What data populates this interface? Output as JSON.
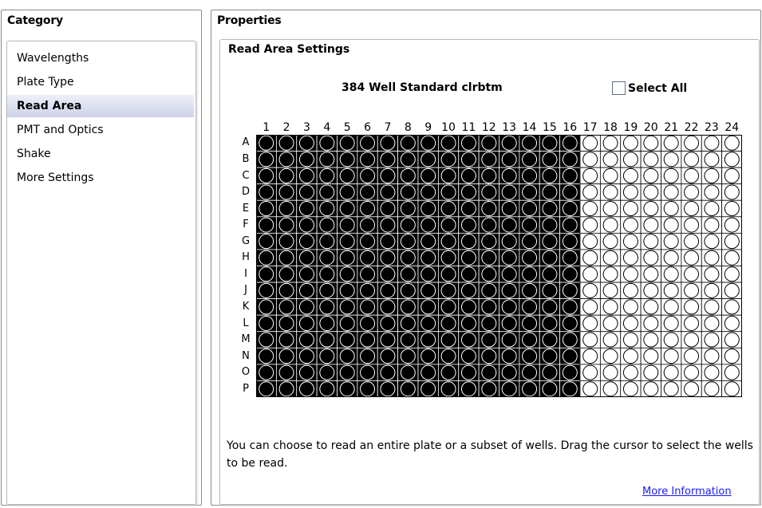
{
  "category_panel": {
    "title": "Category",
    "items": [
      {
        "label": "Wavelengths",
        "selected": false
      },
      {
        "label": "Plate Type",
        "selected": false
      },
      {
        "label": "Read Area",
        "selected": true
      },
      {
        "label": "PMT and Optics",
        "selected": false
      },
      {
        "label": "Shake",
        "selected": false
      },
      {
        "label": "More Settings",
        "selected": false
      }
    ]
  },
  "properties_panel": {
    "title": "Properties",
    "section_title": "Read Area Settings",
    "plate_name": "384 Well Standard clrbtm",
    "select_all_label": "Select All",
    "select_all_checked": false,
    "columns": [
      "1",
      "2",
      "3",
      "4",
      "5",
      "6",
      "7",
      "8",
      "9",
      "10",
      "11",
      "12",
      "13",
      "14",
      "15",
      "16",
      "17",
      "18",
      "19",
      "20",
      "21",
      "22",
      "23",
      "24"
    ],
    "rows": [
      "A",
      "B",
      "C",
      "D",
      "E",
      "F",
      "G",
      "H",
      "I",
      "J",
      "K",
      "L",
      "M",
      "N",
      "O",
      "P"
    ],
    "selected_columns": [
      "1",
      "2",
      "3",
      "4",
      "5",
      "6",
      "7",
      "8",
      "9",
      "10",
      "11",
      "12",
      "13",
      "14",
      "15",
      "16"
    ],
    "selected_color": "#000000",
    "unselected_color": "#ffffff",
    "help_text": "You can choose to read an entire plate or a subset of wells. Drag the cursor to select the wells to be read.",
    "more_info_link": "More Information"
  }
}
